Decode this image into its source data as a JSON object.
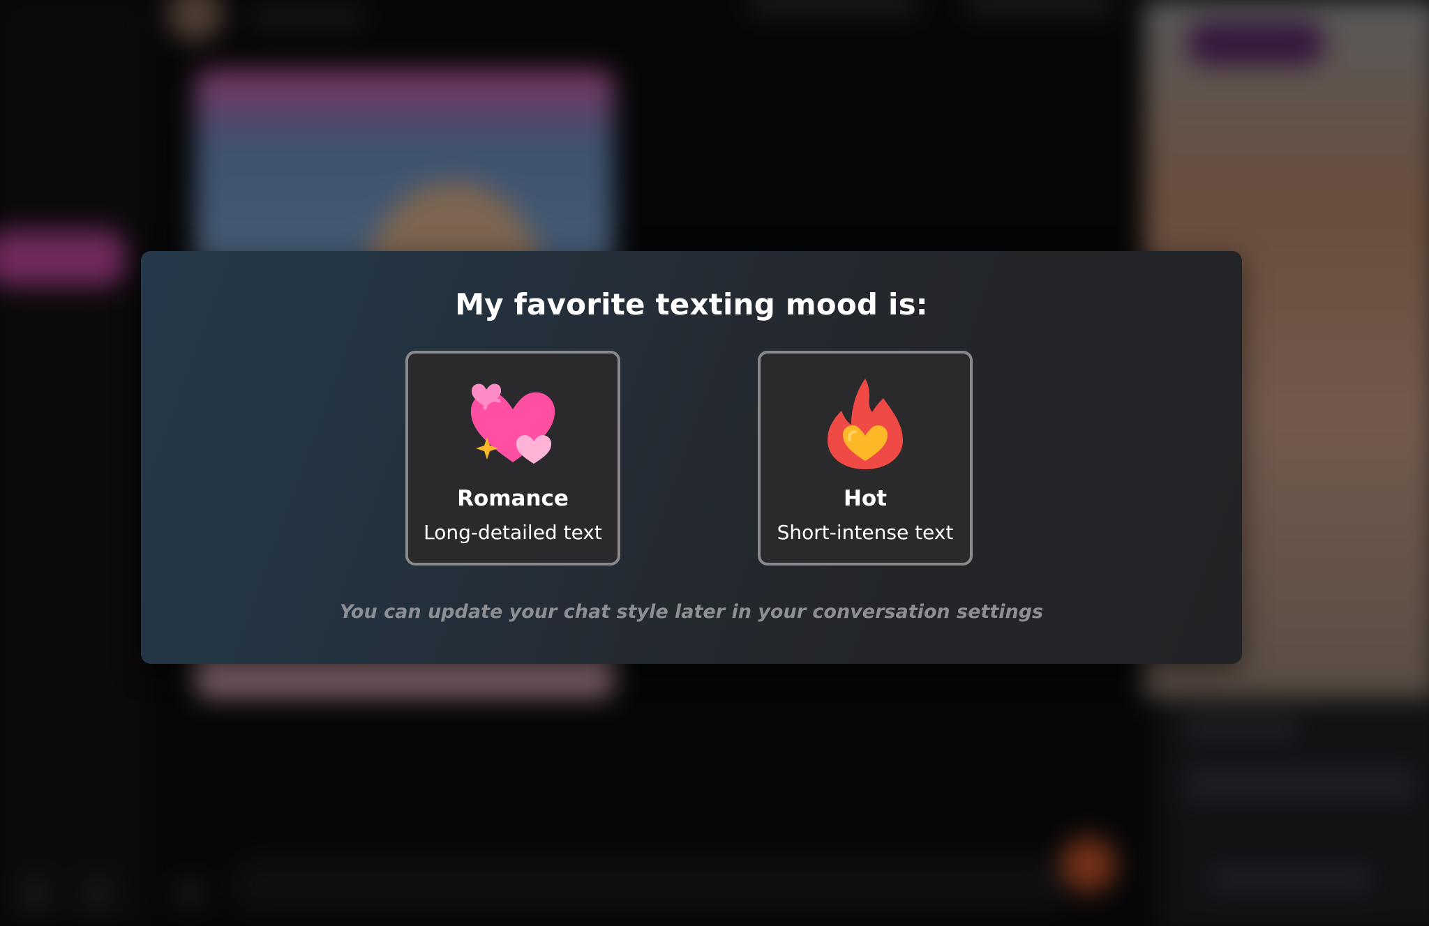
{
  "modal": {
    "title": "My favorite texting mood is:",
    "options": [
      {
        "title": "Romance",
        "subtitle": "Long-detailed text",
        "icon": "hearts-icon"
      },
      {
        "title": "Hot",
        "subtitle": "Short-intense text",
        "icon": "fire-heart-icon"
      }
    ],
    "note": "You can update your chat style later in your conversation settings"
  },
  "colors": {
    "accent_pink": "#ff4fa3",
    "fire_red": "#f04a46",
    "heart_yellow": "#fcb827",
    "card_border": "#8a8a8c"
  }
}
